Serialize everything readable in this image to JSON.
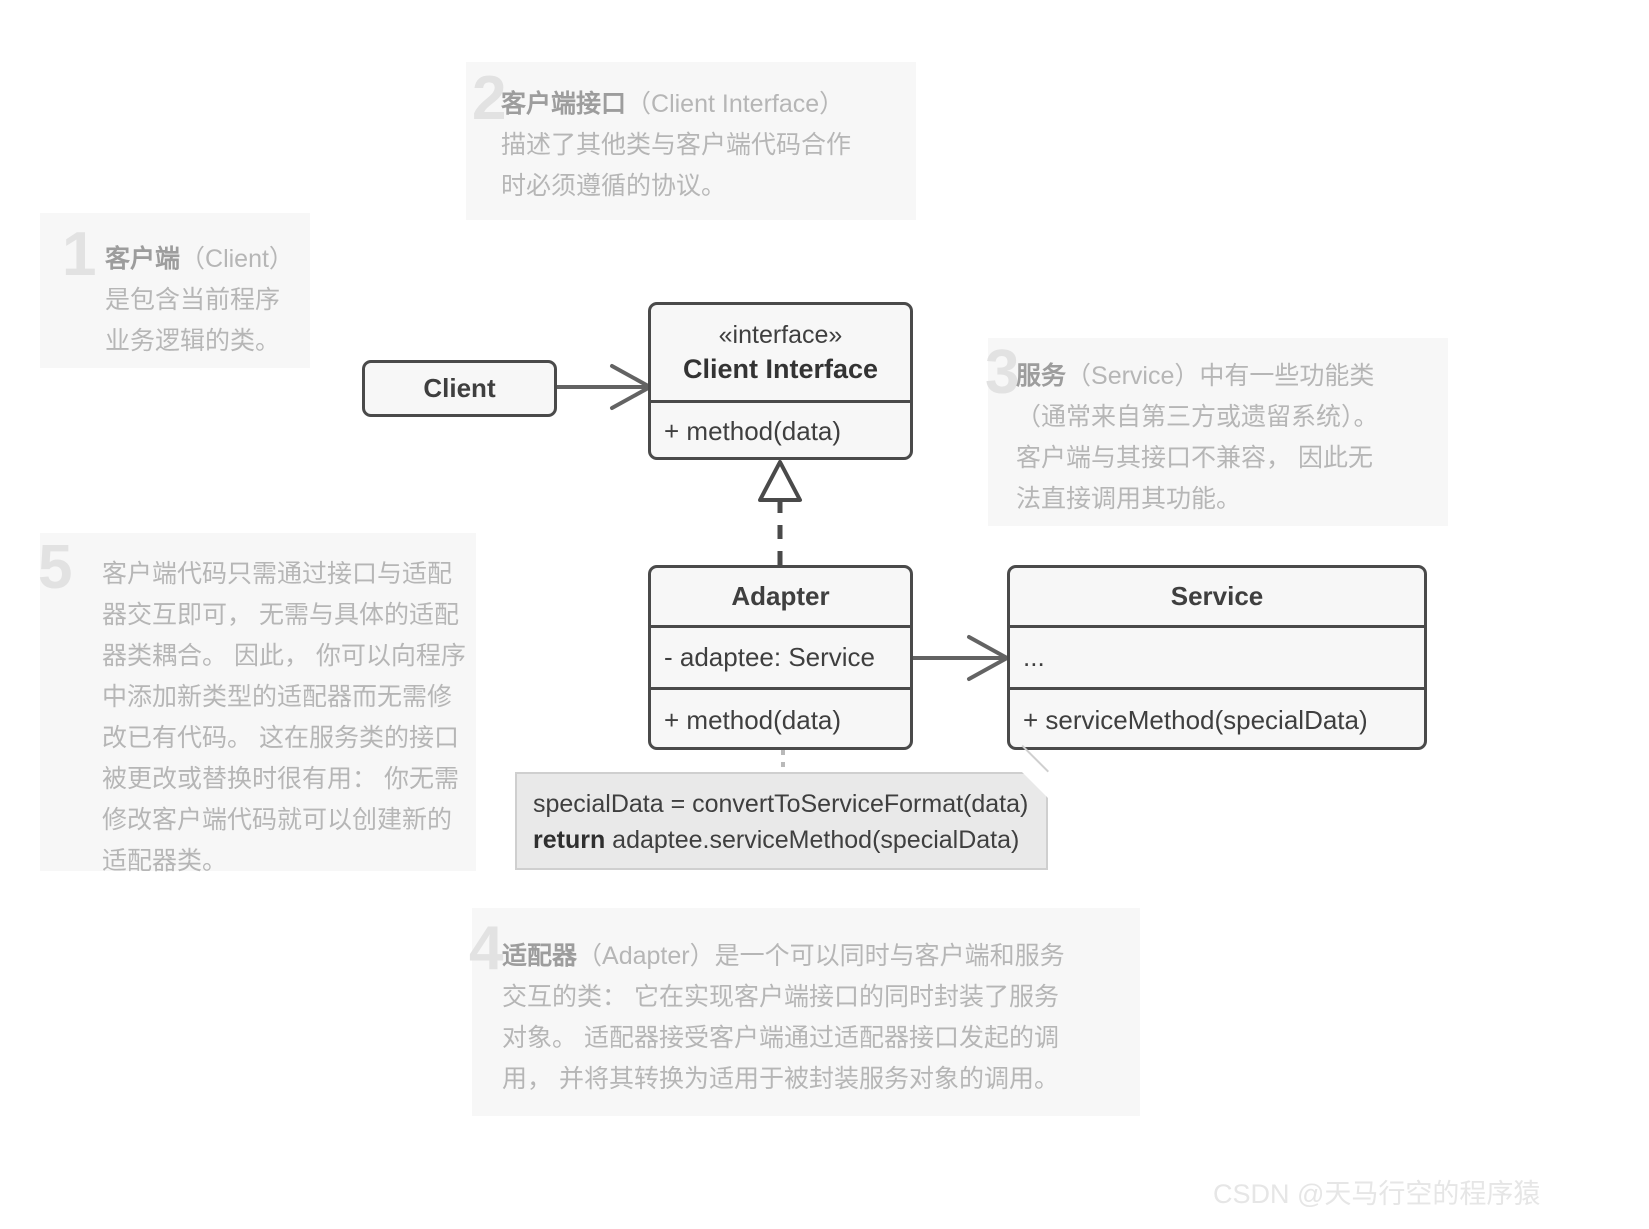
{
  "diagram": {
    "title": "Adapter Design Pattern UML Structure",
    "colors": {
      "box_border": "#4a4a4a",
      "box_fill": "#f7f7f7",
      "note_fill": "#f7f7f7",
      "note_text": "#b6b6b6",
      "note_number": "#e2e2e2",
      "code_note_fill": "#e9e9e9",
      "connector": "#636363",
      "watermark": "#e6e6e6"
    }
  },
  "annotations": [
    {
      "number": "1",
      "heading": "客户端",
      "heading_paren": "（Client）",
      "lines": [
        "是包含当前程序",
        "业务逻辑的类。"
      ],
      "text": "客户端 （Client）是包含当前程序业务逻辑的类。"
    },
    {
      "number": "2",
      "heading": "客户端接口",
      "heading_paren": "（Client Interface）",
      "lines": [
        "描述了其他类与客户端代码合作",
        "时必须遵循的协议。"
      ],
      "text": "客户端接口 （Client Interface）描述了其他类与客户端代码合作时必须遵循的协议。"
    },
    {
      "number": "3",
      "heading": "服务",
      "heading_paren": "（Service）",
      "lines": [
        "中有一些功能类",
        "（通常来自第三方或遗留系统）。",
        "客户端与其接口不兼容， 因此无",
        "法直接调用其功能。"
      ],
      "text": "服务 （Service） 中有一些功能类（通常来自第三方或遗留系统）。客户端与其接口不兼容， 因此无法直接调用其功能。"
    },
    {
      "number": "4",
      "heading": "适配器",
      "heading_paren": "（Adapter）",
      "lines": [
        "是一个可以同时与客户端和服务",
        "交互的类： 它在实现客户端接口的同时封装了服务",
        "对象。 适配器接受客户端通过适配器接口发起的调",
        "用， 并将其转换为适用于被封装服务对象的调用。"
      ],
      "text": "适配器 （Adapter） 是一个可以同时与客户端和服务交互的类： 它在实现客户端接口的同时封装了服务对象。 适配器接受客户端通过适配器接口发起的调用， 并将其转换为适用于被封装服务对象的调用。"
    },
    {
      "number": "5",
      "heading": "",
      "heading_paren": "",
      "lines": [
        "客户端代码只需通过接口与适配",
        "器交互即可， 无需与具体的适配",
        "器类耦合。 因此， 你可以向程序",
        "中添加新类型的适配器而无需修",
        "改已有代码。 这在服务类的接口",
        "被更改或替换时很有用： 你无需",
        "修改客户端代码就可以创建新的",
        "适配器类。"
      ],
      "text": "客户端代码只需通过接口与适配器交互即可， 无需与具体的适配器类耦合。 因此， 你可以向程序中添加新类型的适配器而无需修改已有代码。 这在服务类的接口被更改或替换时很有用： 你无需修改客户端代码就可以创建新的适配器类。"
    }
  ],
  "classes": {
    "client": {
      "name": "Client"
    },
    "client_interface": {
      "stereotype": "«interface»",
      "name": "Client Interface",
      "members": [
        "+ method(data)"
      ]
    },
    "adapter": {
      "name": "Adapter",
      "fields": [
        "- adaptee: Service"
      ],
      "methods": [
        "+ method(data)"
      ]
    },
    "service": {
      "name": "Service",
      "fields": [
        "..."
      ],
      "methods": [
        "+ serviceMethod(specialData)"
      ]
    }
  },
  "code_note": {
    "line1": "specialData = convertToServiceFormat(data)",
    "line2_keyword": "return",
    "line2_rest": " adaptee.serviceMethod(specialData)"
  },
  "relationships": [
    {
      "from": "Client",
      "to": "Client Interface",
      "type": "association-arrow"
    },
    {
      "from": "Adapter",
      "to": "Client Interface",
      "type": "realization-dashed-hollow-triangle"
    },
    {
      "from": "Adapter",
      "to": "Service",
      "type": "association-arrow"
    },
    {
      "from": "Adapter.method(data)",
      "to": "code-note",
      "type": "dotted-anchor"
    }
  ],
  "watermark": {
    "text": "CSDN @天马行空的程序猿"
  }
}
